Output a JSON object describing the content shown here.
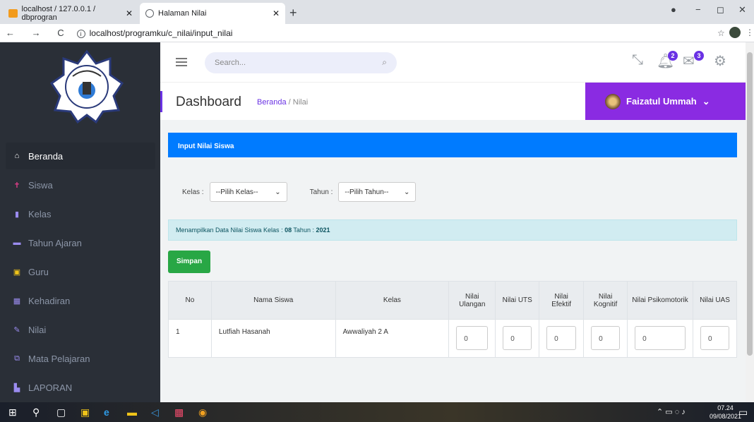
{
  "browser": {
    "tabs": [
      {
        "title": "localhost / 127.0.0.1 / dbprogran",
        "close": "✕"
      },
      {
        "title": "Halaman Nilai",
        "close": "✕"
      }
    ],
    "new_tab": "+",
    "url": "localhost/programku/c_nilai/input_nilai",
    "nav_icons": "← → C",
    "window_controls": {
      "profile": "●",
      "minimize": "−",
      "maximize": "◻",
      "close": "✕"
    }
  },
  "topbar": {
    "search_placeholder": "Search...",
    "notif_badge": "2",
    "mail_badge": "3"
  },
  "header": {
    "title": "Dashboard",
    "breadcrumb_home": "Beranda",
    "breadcrumb_sep": "/",
    "breadcrumb_current": "Nilai",
    "user_name": "Faizatul Ummah",
    "user_caret": "⌄"
  },
  "sidebar": {
    "items": [
      {
        "label": "Beranda",
        "icon": "⌂"
      },
      {
        "label": "Siswa",
        "icon": "✝"
      },
      {
        "label": "Kelas",
        "icon": "▮"
      },
      {
        "label": "Tahun Ajaran",
        "icon": "▬"
      },
      {
        "label": "Guru",
        "icon": "▣"
      },
      {
        "label": "Kehadiran",
        "icon": "▦"
      },
      {
        "label": "Nilai",
        "icon": "✎"
      },
      {
        "label": "Mata Pelajaran",
        "icon": "⧉"
      },
      {
        "label": "LAPORAN",
        "icon": "▙"
      }
    ]
  },
  "content": {
    "card_title": "Input Nilai Siswa",
    "kelas_label": "Kelas :",
    "kelas_value": "--Pilih Kelas--",
    "tahun_label": "Tahun :",
    "tahun_value": "--Pilih Tahun--",
    "info_prefix": "Menampilkan Data Nilai Siswa Kelas : ",
    "info_kelas": "08",
    "info_tahun_label": " Tahun : ",
    "info_tahun": "2021",
    "save_button": "Simpan"
  },
  "table": {
    "headers": [
      "No",
      "Nama Siswa",
      "Kelas",
      "Nilai Ulangan",
      "Nilai UTS",
      "Nilai Efektif",
      "Nilai Kognitif",
      "Nilai Psikomotorik",
      "Nilai UAS"
    ],
    "rows": [
      {
        "no": "1",
        "nama": "Lutfiah Hasanah",
        "kelas": "Awwaliyah 2 A",
        "ulangan": "0",
        "uts": "0",
        "efektif": "0",
        "kognitif": "0",
        "psikomotorik": "0",
        "uas": "0"
      }
    ]
  },
  "taskbar": {
    "time": "07.24",
    "date": "09/08/2021",
    "tray": "⌃ ▭ ◌ ♪"
  }
}
